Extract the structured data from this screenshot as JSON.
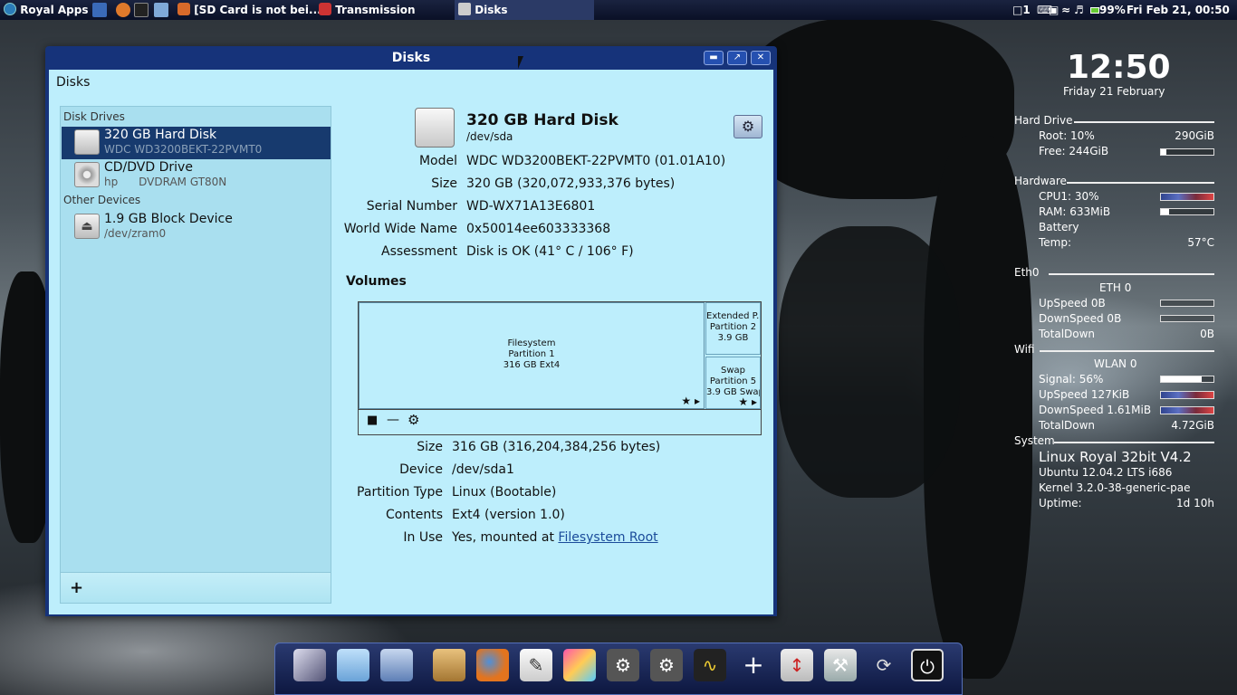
{
  "panel": {
    "apps_label": "Royal Apps",
    "tasks": [
      {
        "label": "[SD Card is not bei..."
      },
      {
        "label": "Transmission"
      },
      {
        "label": "Disks"
      }
    ],
    "notification_count": "1",
    "battery": "99%",
    "datetime": "Fri Feb 21, 00:50"
  },
  "window": {
    "title": "Disks",
    "app_title": "Disks",
    "sidebar": {
      "section_drives": "Disk Drives",
      "section_other": "Other Devices",
      "drives": [
        {
          "name": "320 GB Hard Disk",
          "sub": "WDC WD3200BEKT-22PVMT0"
        },
        {
          "name": "CD/DVD Drive",
          "sub": "hp      DVDRAM GT80N"
        }
      ],
      "other": [
        {
          "name": "1.9 GB Block Device",
          "sub": "/dev/zram0"
        }
      ],
      "add_label": "+"
    },
    "disk": {
      "name": "320 GB Hard Disk",
      "path": "/dev/sda",
      "props": [
        {
          "label": "Model",
          "value": "WDC WD3200BEKT-22PVMT0 (01.01A10)"
        },
        {
          "label": "Size",
          "value": "320 GB (320,072,933,376 bytes)"
        },
        {
          "label": "Serial Number",
          "value": "WD-WX71A13E6801"
        },
        {
          "label": "World Wide Name",
          "value": "0x50014ee603333368"
        },
        {
          "label": "Assessment",
          "value": "Disk is OK (41° C / 106° F)"
        }
      ]
    },
    "volumes": {
      "heading": "Volumes",
      "partitions": [
        {
          "l1": "Filesystem",
          "l2": "Partition 1",
          "l3": "316 GB Ext4"
        },
        {
          "l1": "Extended P...",
          "l2": "Partition 2",
          "l3": "3.9 GB"
        },
        {
          "l1": "Swap",
          "l2": "Partition 5",
          "l3": "3.9 GB Swap"
        }
      ]
    },
    "partition": {
      "props": [
        {
          "label": "Size",
          "value": "316 GB (316,204,384,256 bytes)"
        },
        {
          "label": "Device",
          "value": "/dev/sda1"
        },
        {
          "label": "Partition Type",
          "value": "Linux (Bootable)"
        },
        {
          "label": "Contents",
          "value": "Ext4 (version 1.0)"
        },
        {
          "label": "In Use",
          "value": "Yes, mounted at ",
          "link": "Filesystem Root"
        }
      ]
    }
  },
  "widget": {
    "time": "12:50",
    "date": "Friday 21 February",
    "hard_drive": {
      "title": "Hard Drive",
      "root_label": "Root: 10%",
      "root_value": "290GiB",
      "free_label": "Free: 244GiB",
      "free_fraction": 0.1
    },
    "hardware": {
      "title": "Hardware",
      "cpu_label": "CPU1: 30%",
      "ram_label": "RAM: 633MiB",
      "ram_fraction": 0.15,
      "battery_label": "Battery",
      "temp_label": "Temp:",
      "temp_value": "57°C"
    },
    "eth": {
      "title": "Eth0",
      "iface": "ETH 0",
      "up_label": "UpSpeed 0B",
      "down_label": "DownSpeed 0B",
      "total_label": "TotalDown",
      "total_value": "0B"
    },
    "wifi": {
      "title": "Wifi",
      "iface": "WLAN 0",
      "signal_label": "Signal: 56%",
      "signal_fraction": 0.78,
      "up_label": "UpSpeed 127KiB",
      "down_label": "DownSpeed 1.61MiB",
      "total_label": "TotalDown",
      "total_value": "4.72GiB"
    },
    "system": {
      "title": "System",
      "distro": "Linux Royal 32bit V4.2",
      "ubuntu": "Ubuntu 12.04.2 LTS i686",
      "kernel": "Kernel 3.2.0-38-generic-pae",
      "uptime_label": "Uptime:",
      "uptime_value": "1d 10h"
    }
  }
}
